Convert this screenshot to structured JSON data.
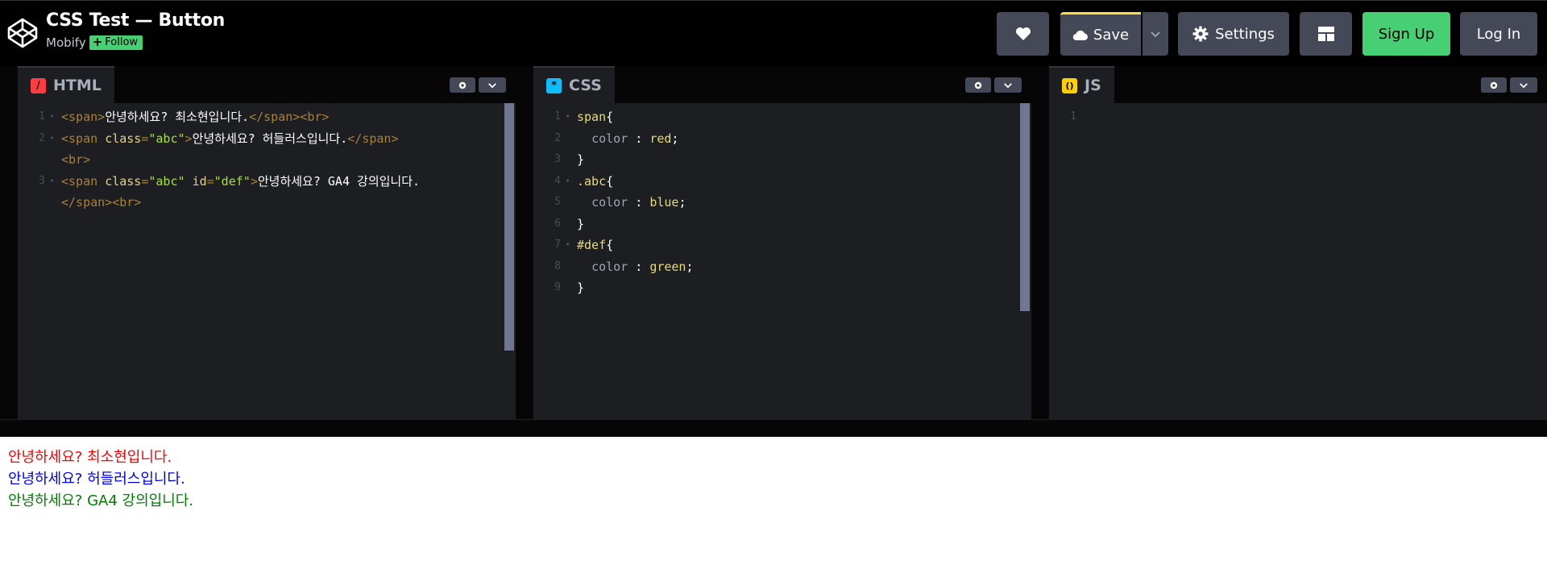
{
  "header": {
    "title": "CSS Test — Button",
    "author": "Mobify",
    "follow_label": "Follow",
    "save_label": "Save",
    "settings_label": "Settings",
    "signup_label": "Sign Up",
    "login_label": "Log In",
    "icons": [
      "codepen-logo-icon",
      "heart-icon",
      "cloud-icon",
      "chevron-down-icon",
      "gear-icon",
      "layout-grid-icon"
    ]
  },
  "colors": {
    "accent_green": "#47cf73",
    "save_border": "#ffdd40",
    "button_bg": "#444857",
    "editor_bg": "#1d1e22"
  },
  "editors": {
    "html": {
      "tab_label": "HTML",
      "lines": [
        {
          "num": "1",
          "fold": "▾",
          "parts": [
            [
              "t-tag",
              "<span>"
            ],
            [
              "t-white",
              "안녕하세요? 최소현입니다."
            ],
            [
              "t-tag",
              "</span><br>"
            ]
          ]
        },
        {
          "num": "2",
          "fold": "▾",
          "parts": [
            [
              "t-tag",
              "<span "
            ],
            [
              "t-attr",
              "class"
            ],
            [
              "t-tag",
              "="
            ],
            [
              "t-str",
              "\"abc\""
            ],
            [
              "t-tag",
              ">"
            ],
            [
              "t-white",
              "안녕하세요? 허들러스입니다."
            ],
            [
              "t-tag",
              "</span>"
            ]
          ]
        },
        {
          "num": "",
          "fold": "",
          "parts": [
            [
              "t-tag",
              "<br>"
            ]
          ]
        },
        {
          "num": "3",
          "fold": "▾",
          "parts": [
            [
              "t-tag",
              "<span "
            ],
            [
              "t-attr",
              "class"
            ],
            [
              "t-tag",
              "="
            ],
            [
              "t-str",
              "\"abc\""
            ],
            [
              "t-tag",
              " "
            ],
            [
              "t-attr",
              "id"
            ],
            [
              "t-tag",
              "="
            ],
            [
              "t-str",
              "\"def\""
            ],
            [
              "t-tag",
              ">"
            ],
            [
              "t-white",
              "안녕하세요? GA4 강의입니다."
            ]
          ]
        },
        {
          "num": "",
          "fold": "",
          "parts": [
            [
              "t-tag",
              "</span>"
            ],
            [
              "t-tag",
              "<br>"
            ]
          ]
        }
      ]
    },
    "css": {
      "tab_label": "CSS",
      "lines": [
        {
          "num": "1",
          "fold": "▾",
          "parts": [
            [
              "t-sel",
              "span"
            ],
            [
              "t-white",
              "{"
            ]
          ]
        },
        {
          "num": "2",
          "fold": "",
          "parts": [
            [
              "t-white",
              "  "
            ],
            [
              "t-prop",
              "color"
            ],
            [
              "t-white",
              " : "
            ],
            [
              "t-val",
              "red"
            ],
            [
              "t-white",
              ";"
            ]
          ]
        },
        {
          "num": "3",
          "fold": "",
          "parts": [
            [
              "t-white",
              "}"
            ]
          ]
        },
        {
          "num": "4",
          "fold": "▾",
          "parts": [
            [
              "t-sel",
              ".abc"
            ],
            [
              "t-white",
              "{"
            ]
          ]
        },
        {
          "num": "5",
          "fold": "",
          "parts": [
            [
              "t-white",
              "  "
            ],
            [
              "t-prop",
              "color"
            ],
            [
              "t-white",
              " : "
            ],
            [
              "t-val",
              "blue"
            ],
            [
              "t-white",
              ";"
            ]
          ]
        },
        {
          "num": "6",
          "fold": "",
          "parts": [
            [
              "t-white",
              "}"
            ]
          ]
        },
        {
          "num": "7",
          "fold": "▾",
          "parts": [
            [
              "t-sel",
              "#def"
            ],
            [
              "t-white",
              "{"
            ]
          ]
        },
        {
          "num": "8",
          "fold": "",
          "parts": [
            [
              "t-white",
              "  "
            ],
            [
              "t-prop",
              "color"
            ],
            [
              "t-white",
              " : "
            ],
            [
              "t-val",
              "green"
            ],
            [
              "t-white",
              ";"
            ]
          ]
        },
        {
          "num": "9",
          "fold": "",
          "parts": [
            [
              "t-white",
              "}"
            ]
          ]
        }
      ]
    },
    "js": {
      "tab_label": "JS",
      "lines": [
        {
          "num": "1",
          "fold": "",
          "parts": []
        }
      ]
    }
  },
  "result": {
    "line1": "안녕하세요? 최소현입니다.",
    "line2": "안녕하세요? 허들러스입니다.",
    "line3": "안녕하세요? GA4 강의입니다."
  }
}
